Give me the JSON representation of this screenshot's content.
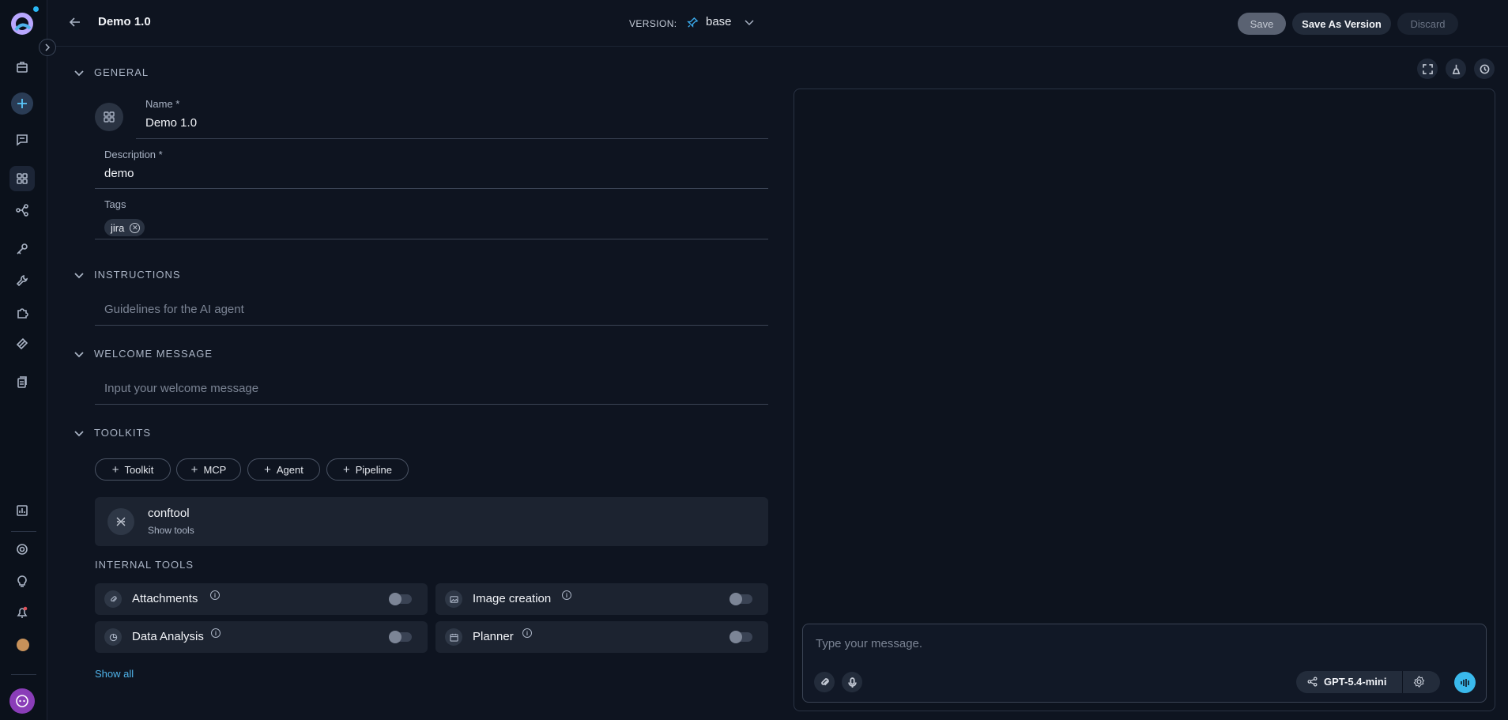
{
  "header": {
    "title": "Demo 1.0",
    "version_label": "VERSION:",
    "version_value": "base",
    "save_label": "Save",
    "save_as_version_label": "Save As Version",
    "discard_label": "Discard",
    "more_label": "⋮"
  },
  "general": {
    "section_title": "GENERAL",
    "name_label": "Name *",
    "name_value": "Demo 1.0",
    "description_label": "Description *",
    "description_value": "demo",
    "tags_label": "Tags",
    "tags": [
      "jira"
    ]
  },
  "instructions": {
    "section_title": "INSTRUCTIONS",
    "placeholder": "Guidelines for the AI agent"
  },
  "welcome": {
    "section_title": "WELCOME MESSAGE",
    "placeholder": "Input your welcome message"
  },
  "toolkits": {
    "section_title": "TOOLKITS",
    "add_buttons": [
      "Toolkit",
      "MCP",
      "Agent",
      "Pipeline"
    ],
    "items": [
      {
        "name": "conftool",
        "show_tools": "Show tools"
      }
    ]
  },
  "internal_tools": {
    "section_title": "INTERNAL TOOLS",
    "tools": [
      {
        "name": "Attachments",
        "icon": "paperclip-icon",
        "enabled": false
      },
      {
        "name": "Image creation",
        "icon": "image-icon",
        "enabled": false
      },
      {
        "name": "Data Analysis",
        "icon": "data-analysis-icon",
        "enabled": false
      },
      {
        "name": "Planner",
        "icon": "calendar-icon",
        "enabled": false
      }
    ],
    "show_all": "Show all"
  },
  "chat": {
    "input_placeholder": "Type your message.",
    "model": "GPT-5.4-mini"
  },
  "colors": {
    "accent": "#3ab9ec",
    "background": "#0e1420",
    "card": "#1c2330"
  }
}
